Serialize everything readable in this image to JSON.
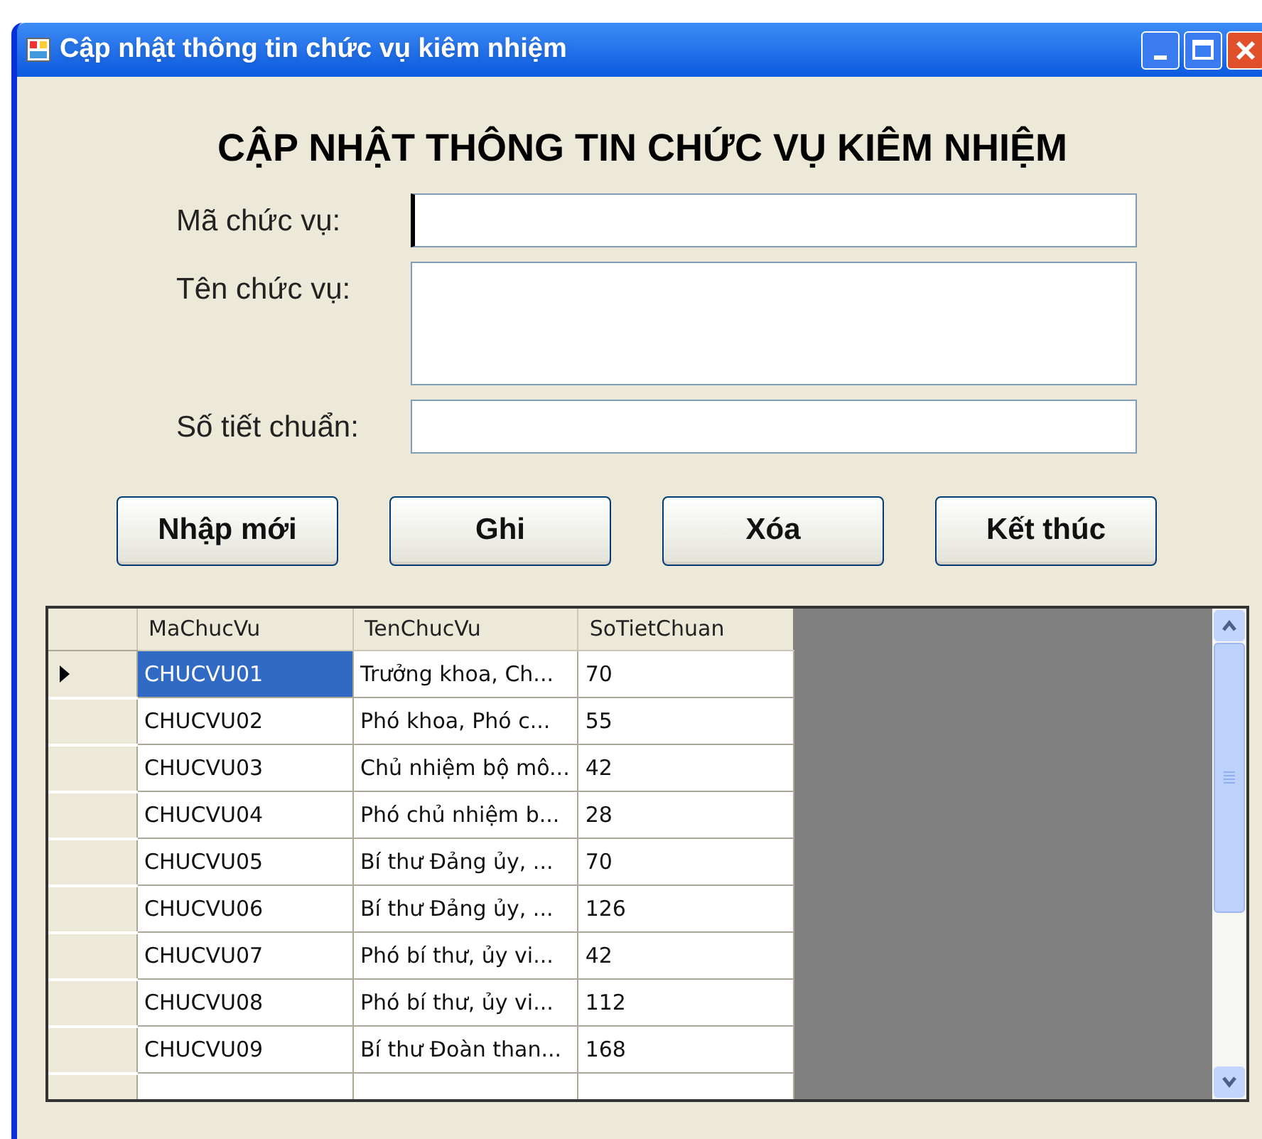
{
  "window": {
    "title": "Cập nhật thông tin chức vụ kiêm nhiệm"
  },
  "heading": "CẬP NHẬT THÔNG TIN CHỨC VỤ KIÊM NHIỆM",
  "fields": [
    {
      "label": "Mã chức vụ:",
      "kind": "text",
      "focused": true
    },
    {
      "label": "Tên chức vụ:",
      "kind": "multiline",
      "focused": false
    },
    {
      "label": "Số tiết chuẩn:",
      "kind": "text",
      "focused": false
    }
  ],
  "buttons": [
    "Nhập mới",
    "Ghi",
    "Xóa",
    "Kết thúc"
  ],
  "table": {
    "columns": [
      "MaChucVu",
      "TenChucVu",
      "SoTietChuan"
    ],
    "rows": [
      {
        "cells": [
          "CHUCVU01",
          "Trưởng khoa, Ch...",
          "70"
        ],
        "selected": true
      },
      {
        "cells": [
          "CHUCVU02",
          "Phó khoa, Phó c...",
          "55"
        ],
        "selected": false
      },
      {
        "cells": [
          "CHUCVU03",
          "Chủ nhiệm bộ mô...",
          "42"
        ],
        "selected": false
      },
      {
        "cells": [
          "CHUCVU04",
          "Phó chủ nhiệm b...",
          "28"
        ],
        "selected": false
      },
      {
        "cells": [
          "CHUCVU05",
          "Bí thư Đảng ủy, ...",
          "70"
        ],
        "selected": false
      },
      {
        "cells": [
          "CHUCVU06",
          "Bí thư Đảng ủy, ...",
          "126"
        ],
        "selected": false
      },
      {
        "cells": [
          "CHUCVU07",
          "Phó bí thư, ủy vi...",
          "42"
        ],
        "selected": false
      },
      {
        "cells": [
          "CHUCVU08",
          "Phó bí thư, ủy vi...",
          "112"
        ],
        "selected": false
      },
      {
        "cells": [
          "CHUCVU09",
          "Bí thư Đoàn than...",
          "168"
        ],
        "selected": false
      }
    ]
  }
}
